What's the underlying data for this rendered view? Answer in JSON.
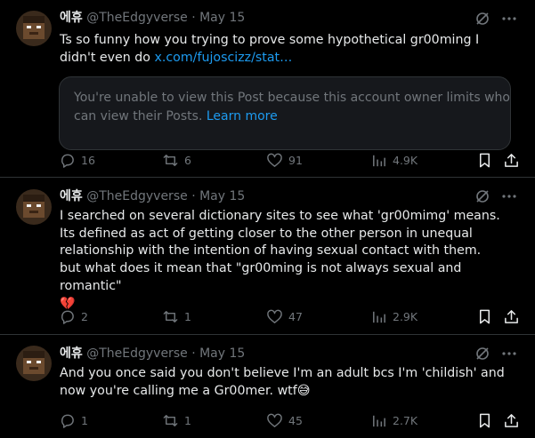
{
  "tweets": [
    {
      "author": "에휴",
      "handle": "@TheEdgyverse",
      "sep": "·",
      "date": "May 15",
      "text_before": "Ts so funny how you trying to prove some hypothetical gr00ming I didn't even do ",
      "link": "x.com/fujoscizz/stat…",
      "quote_text": "You're unable to view this Post because this account owner limits who can view their Posts. ",
      "quote_link": "Learn more",
      "replies": "16",
      "reposts": "6",
      "likes": "91",
      "views": "4.9K"
    },
    {
      "author": "에휴",
      "handle": "@TheEdgyverse",
      "sep": "·",
      "date": "May 15",
      "text_line1": "I searched on several dictionary sites to see what 'gr00mimg' means. Its defined as act of getting closer to the other person in unequal relationship with the intention of having sexual contact with them.",
      "text_line2": "but what does it mean that \"gr00ming is not always sexual and romantic\"",
      "emoji": "💔",
      "replies": "2",
      "reposts": "1",
      "likes": "47",
      "views": "2.9K"
    },
    {
      "author": "에휴",
      "handle": "@TheEdgyverse",
      "sep": "·",
      "date": "May 15",
      "text": "And you once said you don't believe I'm an adult bcs I'm 'childish' and now you're calling me a Gr00mer. wtf",
      "emoji": "😅",
      "replies": "1",
      "reposts": "1",
      "likes": "45",
      "views": "2.7K"
    }
  ],
  "icons": {
    "reply": "reply-icon",
    "repost": "repost-icon",
    "like": "heart-icon",
    "views": "views-icon",
    "bookmark": "bookmark-icon",
    "share": "share-icon",
    "grok": "grok-icon",
    "more": "more-icon"
  },
  "colors": {
    "background": "#000000",
    "text": "#e7e9ea",
    "muted": "#71767b",
    "link": "#1d9bf0",
    "border": "#2f3336"
  }
}
